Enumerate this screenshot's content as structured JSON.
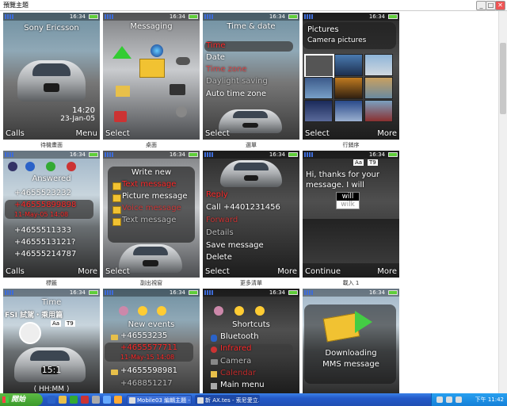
{
  "window": {
    "title": "預覽主題",
    "buttons": {
      "minimize": "_",
      "maximize": "□",
      "close": "✕"
    }
  },
  "status_time": "16:34",
  "phones": [
    {
      "title": "Sony Ericsson",
      "clock": "14:20",
      "date": "23-Jan-05",
      "left": "Calls",
      "right": "Menu",
      "caption": "待機畫面"
    },
    {
      "title": "Messaging",
      "left": "Select",
      "right": "",
      "caption": "桌面"
    },
    {
      "title": "Time & date",
      "items": [
        "Time",
        "Date",
        "Time zone",
        "Daylight saving",
        "Auto time zone"
      ],
      "left": "Select",
      "right": "",
      "caption": "選單"
    },
    {
      "title": "Pictures",
      "subtitle": "Camera pictures",
      "left": "Select",
      "right": "More",
      "caption": "行銷序"
    },
    {
      "title": "Answered",
      "items": [
        "+4655523232",
        "+46555899898",
        "11-May-05   14:08",
        "+4655511333",
        "+4655513121?",
        "+46555214787"
      ],
      "left": "Calls",
      "right": "More",
      "caption": "標籤"
    },
    {
      "title": "Write new",
      "items": [
        "Text message",
        "Picture message",
        "Voice message",
        "Text message"
      ],
      "left": "Select",
      "right": "",
      "caption": "副出視窗"
    },
    {
      "title": "",
      "items": [
        "Reply",
        "Call +4401231456",
        "Forward",
        "Details",
        "Save message",
        "Delete"
      ],
      "left": "Select",
      "right": "More",
      "caption": "更多清單"
    },
    {
      "title": "",
      "badges": [
        "Aa",
        "T9"
      ],
      "message": "Hi, thanks for your message. I will",
      "suggestions": [
        "will",
        "wilk"
      ],
      "left": "Continue",
      "right": "More",
      "caption": "載入 1"
    },
    {
      "title": "Time",
      "ad": "FSI 試駕・乘用篇",
      "badges": [
        "Aa",
        "T9"
      ],
      "clock_value": "15:1",
      "clock_format": "( HH:MM )",
      "left": "",
      "right": "",
      "caption": ""
    },
    {
      "title": "New events",
      "items": [
        "+46553235",
        "+4655577711",
        "11-May-15   14:08",
        "+4655598981",
        "+468851217"
      ],
      "left": "",
      "right": "",
      "caption": ""
    },
    {
      "title": "Shortcuts",
      "items": [
        "Bluetooth",
        "Infrared",
        "Camera",
        "Calendar",
        "Main menu"
      ],
      "left": "",
      "right": "",
      "caption": ""
    },
    {
      "title": "",
      "items": [
        "Downloading",
        "MMS message"
      ],
      "left": "",
      "right": "",
      "caption": ""
    }
  ],
  "taskbar": {
    "start": "開始",
    "items": [
      "Mobile03 編輯主題 - ...",
      "新 AX.tes - 索尼愛立..."
    ],
    "clock": "下午 11:42"
  }
}
